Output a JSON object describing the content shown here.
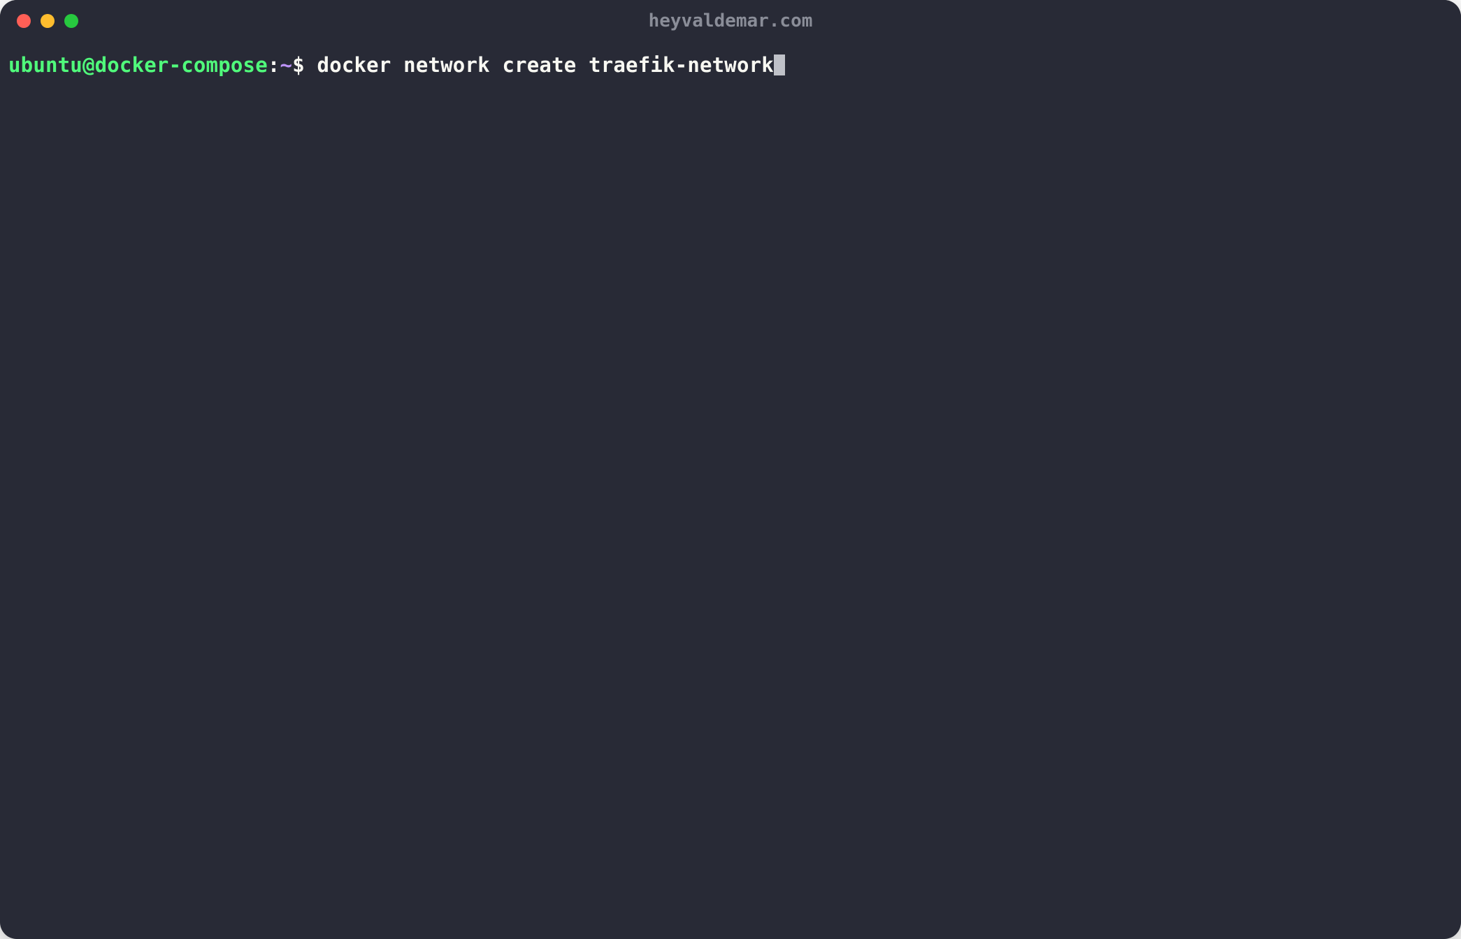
{
  "window": {
    "title": "heyvaldemar.com"
  },
  "prompt": {
    "user_host": "ubuntu@docker-compose",
    "colon": ":",
    "cwd": "~",
    "symbol": "$"
  },
  "command": {
    "text": "docker network create traefik-network"
  }
}
